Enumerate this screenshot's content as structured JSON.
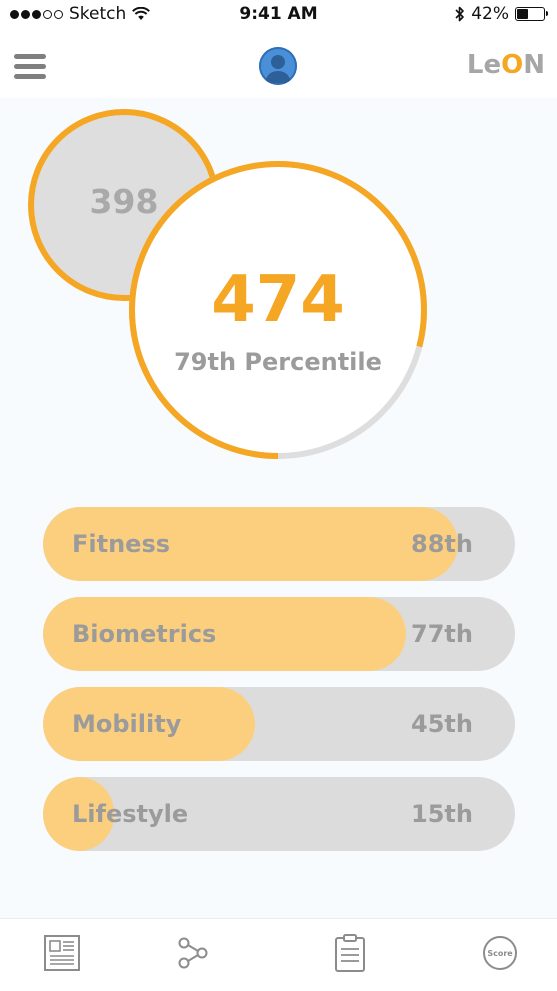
{
  "status_bar": {
    "carrier": "Sketch",
    "time": "9:41 AM",
    "battery": "42%",
    "battery_level": 0.42
  },
  "header": {
    "menu_icon": "hamburger-menu-icon",
    "avatar_icon": "user-avatar-icon",
    "brand_prefix": "Le",
    "brand_o": "O",
    "brand_suffix": "N"
  },
  "scores": {
    "previous_score": "398",
    "current_score": "474",
    "percentile_label": "79th Percentile",
    "percentile_value": 79
  },
  "categories": [
    {
      "label": "Fitness",
      "value": "88th",
      "percent": 88
    },
    {
      "label": "Biometrics",
      "value": "77th",
      "percent": 77
    },
    {
      "label": "Mobility",
      "value": "45th",
      "percent": 45
    },
    {
      "label": "Lifestyle",
      "value": "15th",
      "percent": 15
    }
  ],
  "tabs": [
    {
      "name": "news-tab",
      "icon": "newspaper-icon"
    },
    {
      "name": "connections-tab",
      "icon": "share-nodes-icon"
    },
    {
      "name": "clipboard-tab",
      "icon": "clipboard-icon"
    },
    {
      "name": "score-tab",
      "icon": "score-badge-icon",
      "label": "Score"
    }
  ],
  "colors": {
    "accent": "#f5a623",
    "bar_fill": "#fbcf7e",
    "bar_track": "#dcdcdc",
    "text_muted": "#9b9b9b",
    "background": "#f7fbfd"
  }
}
